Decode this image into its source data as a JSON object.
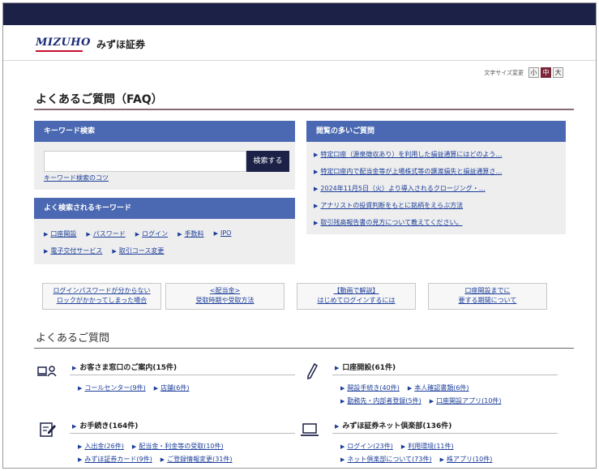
{
  "header": {
    "logo": "MIZUHO",
    "brand": "みずほ証券"
  },
  "font_size": {
    "label": "文字サイズ変更",
    "options": [
      "小",
      "中",
      "大"
    ],
    "selected": "中"
  },
  "page_title": "よくあるご質問（FAQ）",
  "keyword_search": {
    "heading": "キーワード検索",
    "input_value": "",
    "button_label": "検索する",
    "tips_link": "キーワード検索のコツ"
  },
  "popular_keywords": {
    "heading": "よく検索されるキーワード",
    "row1": [
      "口座開設",
      "パスワード",
      "ログイン",
      "手数料",
      "IPO"
    ],
    "row2": [
      "電子交付サービス",
      "取引コース変更"
    ]
  },
  "frequent_questions": {
    "heading": "閲覧の多いご質問",
    "items": [
      "特定口座（源泉徴収あり）を利用した損益通算にはどのよう…",
      "特定口座内で配当金等が上場株式等の譲渡損失と損益通算さ…",
      "2024年11月5日（火）より導入されるクロージング・…",
      "アナリストの投資判断をもとに銘柄をえらぶ方法",
      "取引残高報告書の見方について教えてください。"
    ]
  },
  "quick_links": [
    {
      "line1": "ログインパスワードが分からない",
      "line2": "ロックがかかってしまった場合"
    },
    {
      "line1": "<配当金>",
      "line2": "受取時期や受取方法"
    },
    {
      "line1": "【動画で解説】",
      "line2": "はじめてログインするには"
    },
    {
      "line1": "口座開設までに",
      "line2": "要する期間について"
    }
  ],
  "faq_section": {
    "title": "よくあるご質問",
    "categories": [
      {
        "icon": "customer-service-icon",
        "title": "お客さま窓口のご案内(15件)",
        "rows": [
          [
            "コールセンター(9件)",
            "店舗(6件)"
          ]
        ]
      },
      {
        "icon": "pen-icon",
        "title": "口座開設(61件)",
        "rows": [
          [
            "開設手続き(40件)",
            "本人確認書類(6件)"
          ],
          [
            "勤務先・内部者登録(5件)",
            "口座開設アプリ(10件)"
          ]
        ]
      },
      {
        "icon": "form-edit-icon",
        "title": "お手続き(164件)",
        "rows": [
          [
            "入出金(26件)",
            "配当金・利金等の受取(10件)"
          ],
          [
            "みずほ証券カード(9件)",
            "ご登録情報変更(31件)"
          ]
        ]
      },
      {
        "icon": "laptop-icon",
        "title": "みずほ証券ネット倶楽部(136件)",
        "rows": [
          [
            "ログイン(23件)",
            "利用環境(11件)"
          ],
          [
            "ネット倶楽部について(73件)",
            "株アプリ(10件)"
          ]
        ]
      }
    ]
  },
  "colors": {
    "topbar": "#1b2147",
    "panel_header": "#4b69b2",
    "link": "#1d3f9a",
    "title_rule": "#8a6a72",
    "logo_accent": "#c8102e"
  }
}
